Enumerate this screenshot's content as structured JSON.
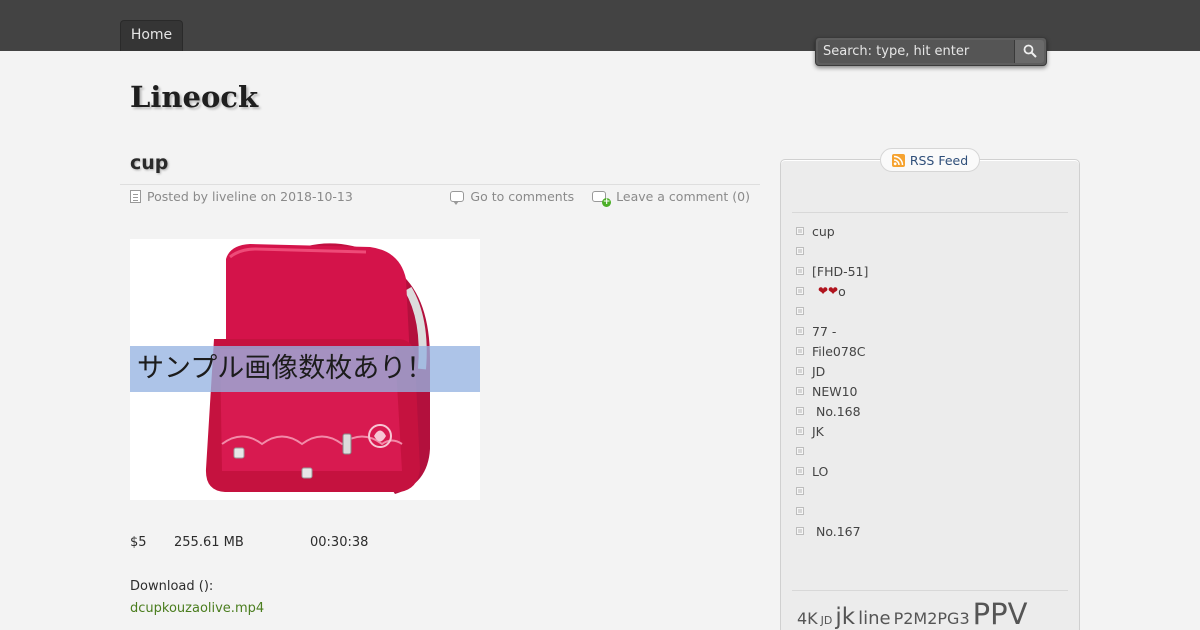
{
  "nav": {
    "home_label": "Home"
  },
  "search": {
    "placeholder": "Search: type, hit enter"
  },
  "site": {
    "title": "Lineock"
  },
  "post": {
    "title": "cup",
    "meta": {
      "posted_by": "Posted by liveline on 2018-10-13",
      "go_to_comments": "Go to comments",
      "leave_comment": "Leave a comment (0)"
    },
    "image_banner": "サンプル画像数枚あり！",
    "price": "$5",
    "size": "255.61 MB",
    "duration": "00:30:38",
    "download_label": "Download ():",
    "download_link": "dcupkouzaolive.mp4"
  },
  "sidebar": {
    "rss_label": "RSS Feed",
    "items": [
      {
        "label": "cup"
      },
      {
        "label": ""
      },
      {
        "label": "[FHD-51]"
      },
      {
        "label": "o",
        "hearts": "❤❤"
      },
      {
        "label": ""
      },
      {
        "label": "77 -"
      },
      {
        "label": "File078C"
      },
      {
        "label": "JD"
      },
      {
        "label": "NEW10"
      },
      {
        "label": " No.168"
      },
      {
        "label": "JK"
      },
      {
        "label": ""
      },
      {
        "label": "LO"
      },
      {
        "label": ""
      },
      {
        "label": ""
      },
      {
        "label": " No.167"
      }
    ],
    "tags": [
      {
        "label": "4K",
        "size": 16
      },
      {
        "label": "JD",
        "size": 11
      },
      {
        "label": "jk",
        "size": 23
      },
      {
        "label": "line",
        "size": 18
      },
      {
        "label": "P2M2PG3",
        "size": 16
      },
      {
        "label": "PPV",
        "size": 29
      }
    ]
  },
  "colors": {
    "topbar": "#434343",
    "link_green": "#4a7d1e",
    "heart_red": "#b0141e",
    "backpack_pink": "#d4134a"
  }
}
